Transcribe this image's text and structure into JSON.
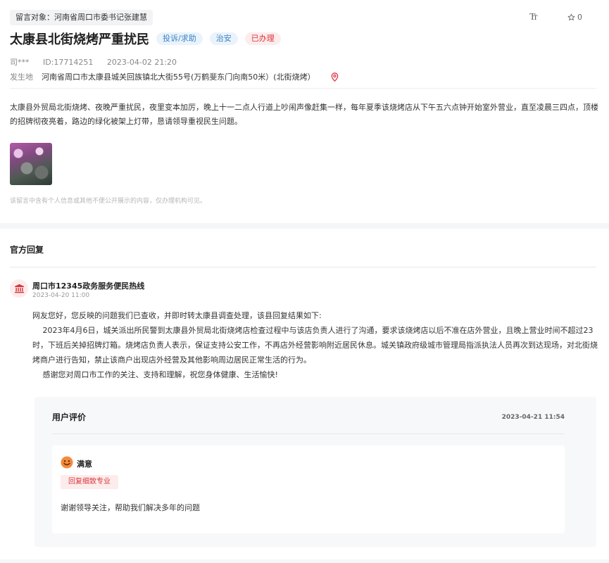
{
  "header": {
    "target_tag": "留言对象：河南省周口市委书记张建慧",
    "font_size_label": "Tт",
    "star_count": "0",
    "star_icon": "star-outline-icon"
  },
  "message": {
    "title": "太康县北街烧烤严重扰民",
    "badges": [
      "投诉/求助",
      "治安",
      "已办理"
    ],
    "author": "司***",
    "id": "ID:17714251",
    "time": "2023-04-02 21:20",
    "location_label": "发生地",
    "location": "河南省周口市太康县城关回族镇北大街55号(万鹤斐东门向南50米）(北街烧烤）",
    "body": "太康县外贸局北街烧烤、夜晚严重扰民，夜里变本加厉，晚上十一二点人行道上吵闹声像赶集一样，每年夏季该烧烤店从下午五六点钟开始室外营业，直至凌晨三四点，顶楼的招牌彻夜亮着，路边的绿化被架上灯带，恳请领导重视民生问题。",
    "privacy_note": "该留言中含有个人信息或其他不便公开展示的内容，仅办理机构可见。"
  },
  "reply": {
    "section_title": "官方回复",
    "org_name": "周口市12345政务服务便民热线",
    "org_time": "2023-04-20 11:00",
    "paragraphs": [
      "网友您好，您反映的问题我们已查收，并即时转太康县调查处理，该县回复结果如下:",
      "　 2023年4月6日，城关派出所民警到太康县外贸局北街烧烤店检查过程中与该店负责人进行了沟通，要求该烧烤店以后不准在店外营业，且晚上营业时间不超过23时，下班后关掉招牌灯箱。烧烤店负责人表示，保证支持公安工作，不再店外经营影响附近居民休息。城关镇政府级城市管理局指派执法人员再次到达现场，对北街烧烤商户进行告知，禁止该商户出现店外经营及其他影响周边居民正常生活的行为。",
      "　 感谢您对周口市工作的关注、支持和理解，祝您身体健康、生活愉快!"
    ]
  },
  "evaluation": {
    "title": "用户评价",
    "time": "2023-04-21 11:54",
    "rating": "满意",
    "tag": "回复细致专业",
    "comment": "谢谢领导关注，帮助我们解决多年的问题"
  },
  "colors": {
    "accent_red": "#d9363e",
    "accent_blue": "#3b82c4",
    "tag_bg": "#f2f3f5",
    "section_bg": "#f5f6f7"
  }
}
